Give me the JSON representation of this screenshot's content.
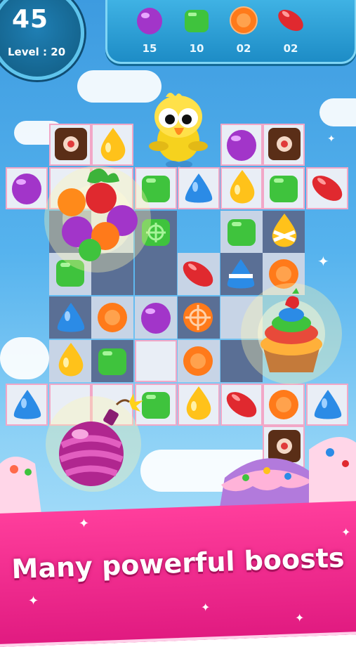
{
  "hud": {
    "moves_left": "45",
    "level_label": "Level : 20"
  },
  "goals": [
    {
      "icon": "purple-round-candy-icon",
      "count": "15"
    },
    {
      "icon": "green-square-candy-icon",
      "count": "10"
    },
    {
      "icon": "orange-disc-candy-icon",
      "count": "02"
    },
    {
      "icon": "red-jellybean-candy-icon",
      "count": "02"
    }
  ],
  "banner": {
    "text": "Many powerful boosts"
  },
  "colors": {
    "purple": "#a235c9",
    "green": "#3fc33d",
    "orange": "#ff7a1a",
    "red": "#e0292f",
    "blue": "#2b8be6",
    "yellow": "#ffc21a",
    "banner_pink": "#f02a8e"
  },
  "boosts": [
    "fruit-cluster-boost-icon",
    "cupcake-boost-icon",
    "bomb-boost-icon"
  ],
  "mascot": "yellow-bird-mascot-icon"
}
